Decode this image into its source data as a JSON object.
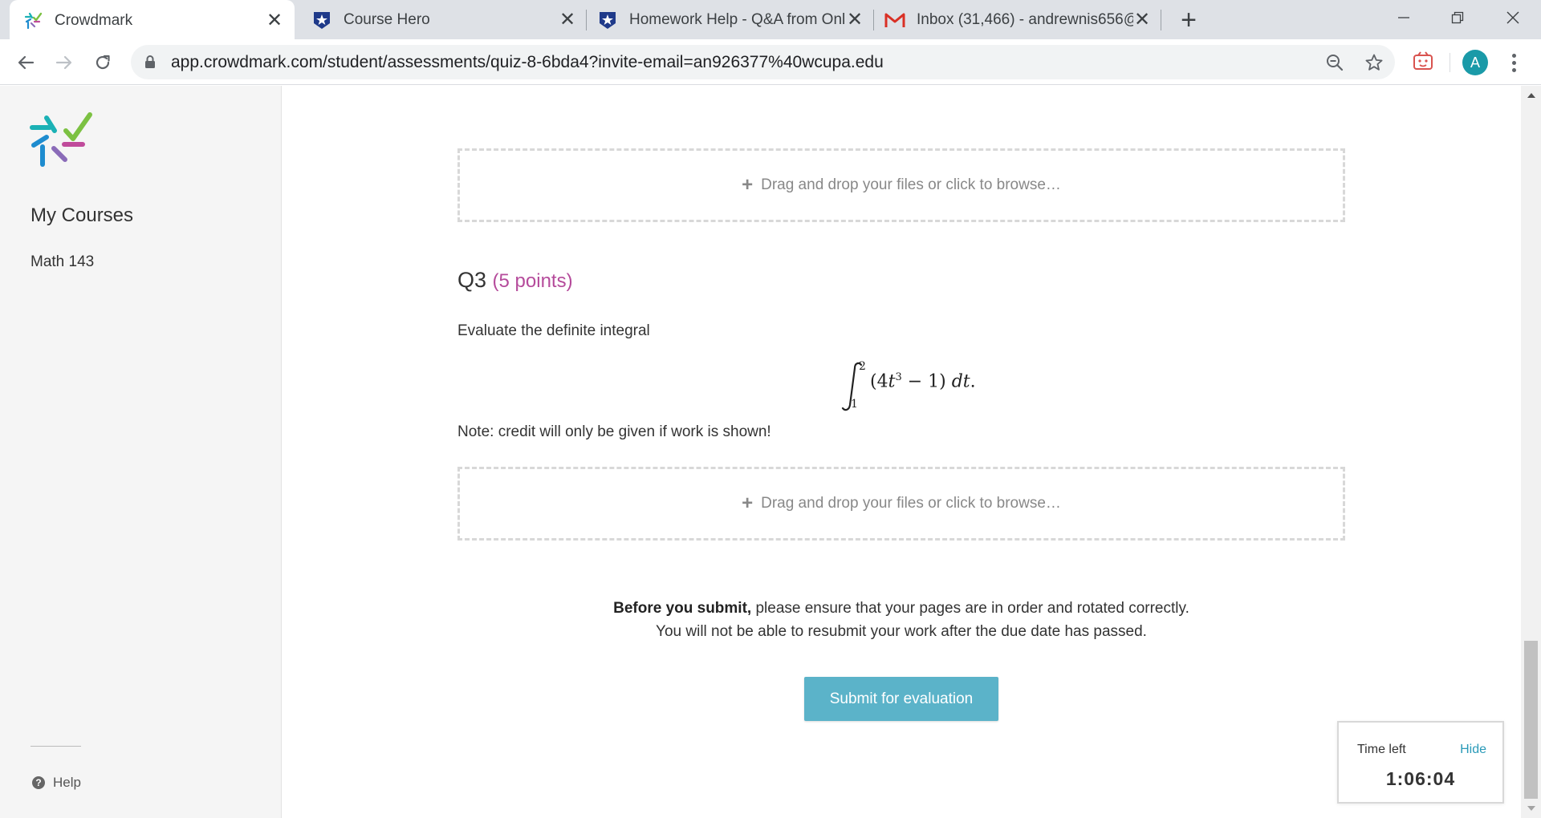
{
  "browser": {
    "tabs": [
      {
        "title": "Crowdmark",
        "icon": "crowdmark-icon",
        "active": true
      },
      {
        "title": "Course Hero",
        "icon": "course-hero-icon",
        "active": false
      },
      {
        "title": "Homework Help - Q&A from Onl",
        "icon": "course-hero-icon",
        "active": false
      },
      {
        "title": "Inbox (31,466) - andrewnis656@",
        "icon": "gmail-icon",
        "active": false
      }
    ],
    "new_tab_label": "+",
    "url": "app.crowdmark.com/student/assessments/quiz-8-6bda4?invite-email=an926377%40wcupa.edu",
    "avatar_letter": "A"
  },
  "sidebar": {
    "heading": "My Courses",
    "courses": [
      "Math 143"
    ],
    "help_label": "Help"
  },
  "main": {
    "dropzone_label": "Drag and drop your files or click to browse…",
    "question": {
      "number": "Q3",
      "points": "(5 points)",
      "prompt": "Evaluate the definite integral",
      "integral": {
        "lower": "1",
        "upper": "2",
        "integrand_open": "(4",
        "variable": "t",
        "exponent": "3",
        "integrand_close": " − 1) ",
        "differential": "dt",
        "period": "."
      },
      "note": "Note: credit will only be given if work is shown!"
    },
    "submit_notice_bold": "Before you submit,",
    "submit_notice_rest": " please ensure that your pages are in order and rotated correctly.",
    "submit_notice_line2": "You will not be able to resubmit your work after the due date has passed.",
    "submit_button": "Submit for evaluation"
  },
  "timer": {
    "label": "Time left",
    "hide_label": "Hide",
    "value": "1:06:04"
  },
  "colors": {
    "accent": "#5bb3c9",
    "points": "#b54b9b",
    "link": "#2a9ab8"
  }
}
